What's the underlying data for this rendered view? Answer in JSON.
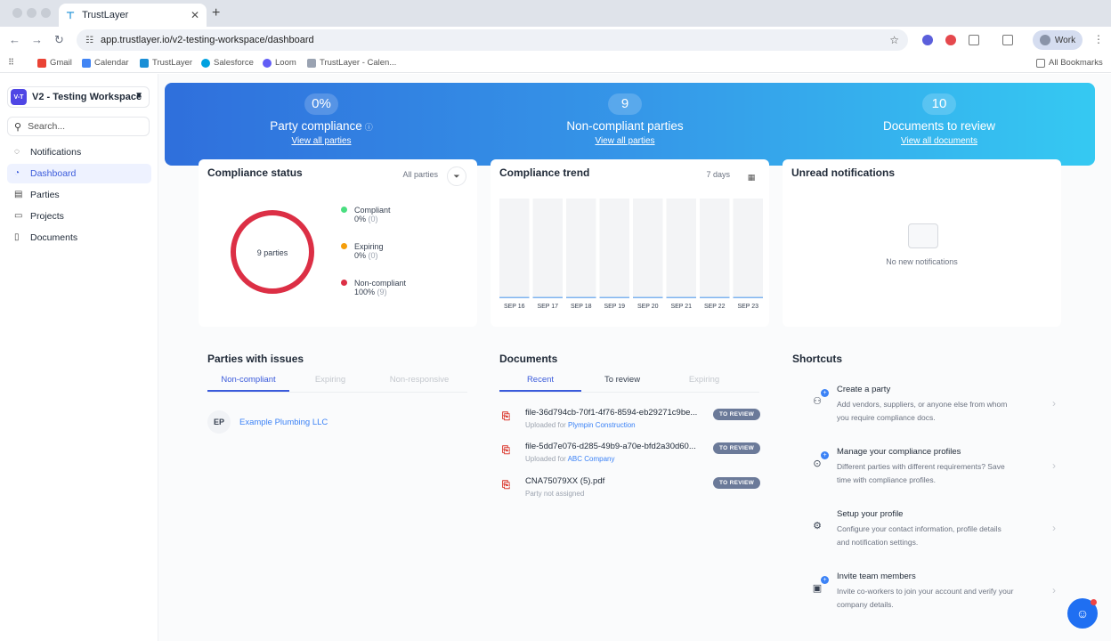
{
  "browser": {
    "tab_title": "TrustLayer",
    "url": "app.trustlayer.io/v2-testing-workspace/dashboard",
    "profile_label": "Work",
    "bookmarks": [
      "Gmail",
      "Calendar",
      "TrustLayer",
      "Salesforce",
      "Loom",
      "TrustLayer - Calen..."
    ],
    "all_bookmarks": "All Bookmarks"
  },
  "sidebar": {
    "workspace_badge": "V-T",
    "workspace_name": "V2 - Testing Workspace",
    "search_placeholder": "Search...",
    "items": [
      {
        "label": "Notifications",
        "icon": "bell-icon"
      },
      {
        "label": "Dashboard",
        "icon": "dashboard-icon",
        "active": true
      },
      {
        "label": "Parties",
        "icon": "parties-icon"
      },
      {
        "label": "Projects",
        "icon": "folder-icon"
      },
      {
        "label": "Documents",
        "icon": "document-icon"
      }
    ]
  },
  "hero": {
    "kpis": [
      {
        "value": "0%",
        "label": "Party compliance",
        "link": "View all parties"
      },
      {
        "value": "9",
        "label": "Non-compliant parties",
        "link": "View all parties"
      },
      {
        "value": "10",
        "label": "Documents to review",
        "link": "View all documents"
      }
    ]
  },
  "compliance_status": {
    "title": "Compliance status",
    "filter_label": "All parties",
    "center_label": "9 parties",
    "legend": [
      {
        "name": "Compliant",
        "value": "0%",
        "count": "(0)",
        "color": "#4ade80"
      },
      {
        "name": "Expiring",
        "value": "0%",
        "count": "(0)",
        "color": "#f59e0b"
      },
      {
        "name": "Non-compliant",
        "value": "100%",
        "count": "(9)",
        "color": "#dc2f45"
      }
    ]
  },
  "compliance_trend": {
    "title": "Compliance trend",
    "range": "7 days"
  },
  "chart_data": {
    "type": "bar",
    "categories": [
      "SEP 16",
      "SEP 17",
      "SEP 18",
      "SEP 19",
      "SEP 20",
      "SEP 21",
      "SEP 22",
      "SEP 23"
    ],
    "values": [
      0,
      0,
      0,
      0,
      0,
      0,
      0,
      0
    ],
    "title": "Compliance trend",
    "xlabel": "",
    "ylabel": "",
    "grid": false
  },
  "notifications": {
    "title": "Unread notifications",
    "empty_text": "No new notifications"
  },
  "parties_issues": {
    "title": "Parties with issues",
    "tabs": [
      "Non-compliant",
      "Expiring",
      "Non-responsive"
    ],
    "rows": [
      {
        "initials": "EP",
        "name": "Example Plumbing LLC"
      }
    ]
  },
  "documents": {
    "title": "Documents",
    "tabs": [
      "Recent",
      "To review",
      "Expiring"
    ],
    "rows": [
      {
        "name": "file-36d794cb-70f1-4f76-8594-eb29271c9be...",
        "sub_prefix": "Uploaded for ",
        "sub_link": "Plympin Construction",
        "tag": "TO REVIEW"
      },
      {
        "name": "file-5dd7e076-d285-49b9-a70e-bfd2a30d60...",
        "sub_prefix": "Uploaded for ",
        "sub_link": "ABC Company",
        "tag": "TO REVIEW"
      },
      {
        "name": "CNA75079XX (5).pdf",
        "sub_prefix": "Party not assigned",
        "sub_link": "",
        "tag": "TO REVIEW"
      }
    ]
  },
  "shortcuts": {
    "title": "Shortcuts",
    "items": [
      {
        "title": "Create a party",
        "desc": "Add vendors, suppliers, or anyone else from whom you require compliance docs."
      },
      {
        "title": "Manage your compliance profiles",
        "desc": "Different parties with different requirements? Save time with compliance profiles."
      },
      {
        "title": "Setup your profile",
        "desc": "Configure your contact information, profile details and notification settings."
      },
      {
        "title": "Invite team members",
        "desc": "Invite co-workers to join your account and verify your company details."
      }
    ]
  },
  "colors": {
    "accent": "#3b5bdb",
    "donut": "#dc2f45",
    "hero_start": "#2f6fdc",
    "hero_end": "#35c9f2"
  }
}
